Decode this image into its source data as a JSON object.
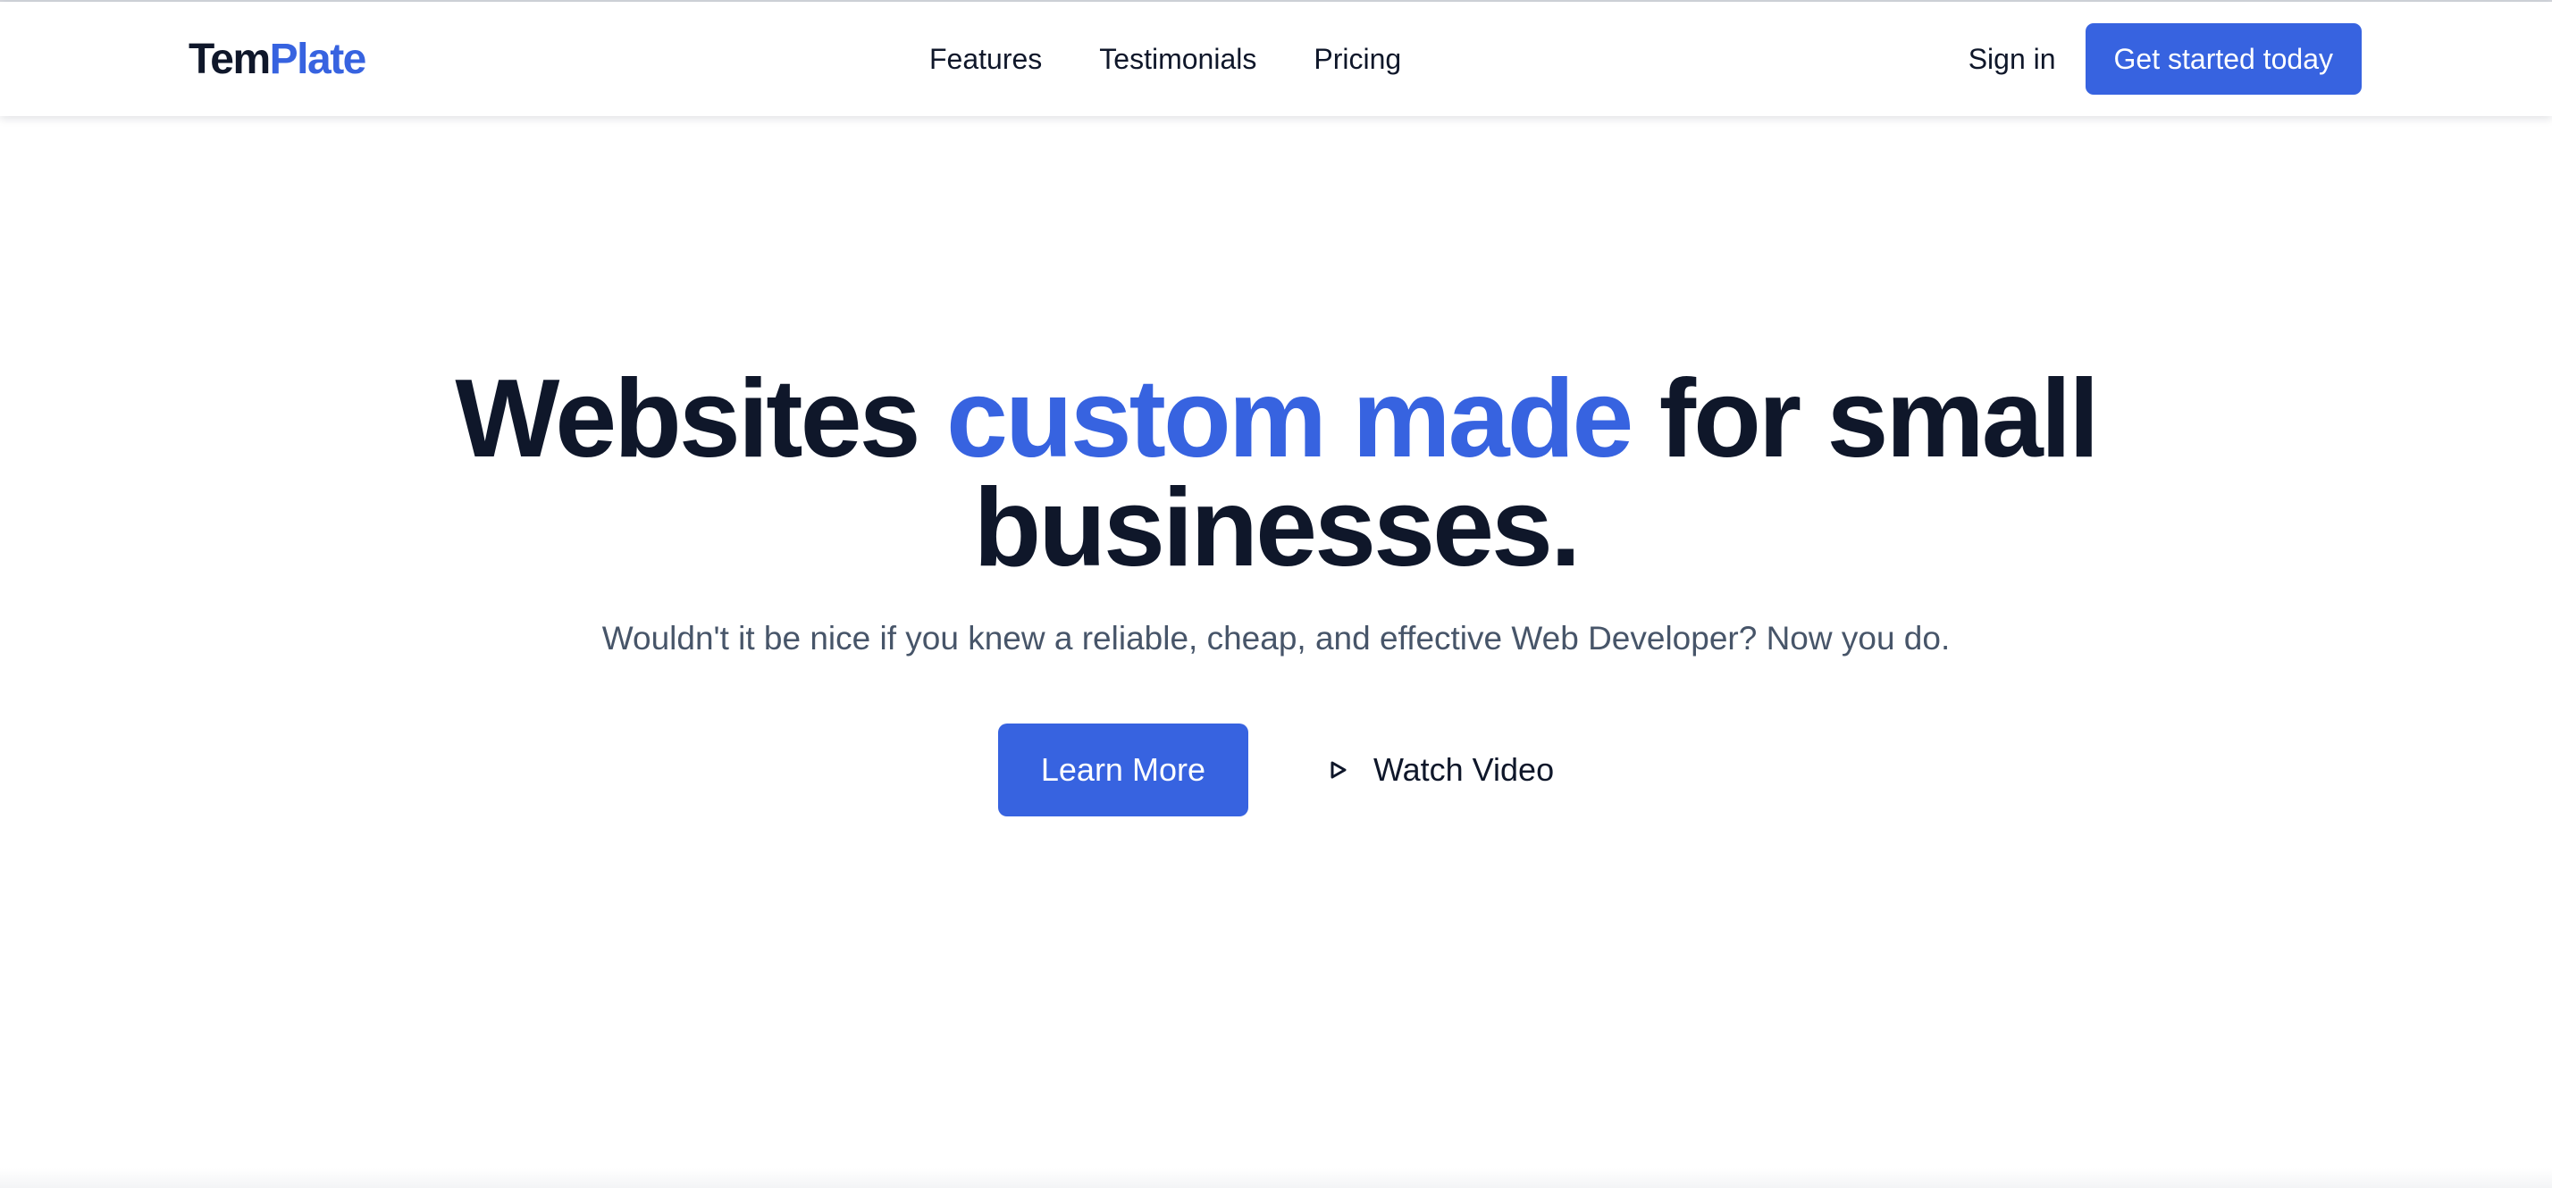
{
  "brand": {
    "logo_part1": "Tem",
    "logo_part2": "Plate",
    "accent_color": "#3763e0",
    "text_color": "#0f172a"
  },
  "nav": {
    "links": [
      {
        "label": "Features"
      },
      {
        "label": "Testimonials"
      },
      {
        "label": "Pricing"
      }
    ],
    "sign_in": "Sign in",
    "cta": "Get started today"
  },
  "hero": {
    "headline_part1": "Websites ",
    "headline_accent": "custom made",
    "headline_part2": " for small",
    "headline_line2": "businesses.",
    "subtitle": "Wouldn't it be nice if you knew a reliable, cheap, and effective Web Developer? Now you do.",
    "primary_button": "Learn More",
    "secondary_button": "Watch Video",
    "secondary_icon": "play-icon"
  }
}
